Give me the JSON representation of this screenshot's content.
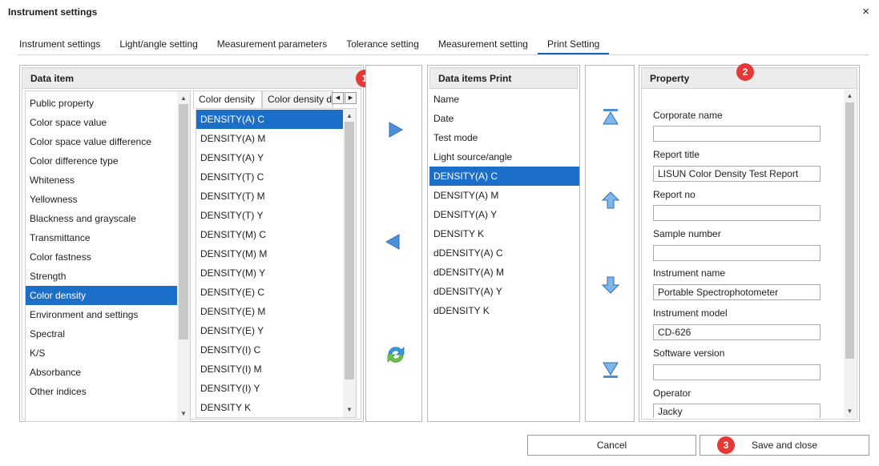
{
  "window": {
    "title": "Instrument settings",
    "close_glyph": "×"
  },
  "tabs": [
    {
      "label": "Instrument settings"
    },
    {
      "label": "Light/angle setting"
    },
    {
      "label": "Measurement parameters"
    },
    {
      "label": "Tolerance setting"
    },
    {
      "label": "Measurement setting"
    },
    {
      "label": "Print Setting",
      "active": true
    }
  ],
  "data_item": {
    "header": "Data item",
    "categories": [
      "Public property",
      "Color space value",
      "Color space value difference",
      "Color difference type",
      "Whiteness",
      "Yellowness",
      "Blackness and grayscale",
      "Transmittance",
      "Color fastness",
      "Strength",
      "Color density",
      "Environment and settings",
      "Spectral",
      "K/S",
      "Absorbance",
      "Other indices"
    ],
    "selected_category": "Color density",
    "subtabs": [
      "Color density",
      "Color density d"
    ],
    "items": [
      "DENSITY(A) C",
      "DENSITY(A) M",
      "DENSITY(A) Y",
      "DENSITY(T) C",
      "DENSITY(T) M",
      "DENSITY(T) Y",
      "DENSITY(M) C",
      "DENSITY(M) M",
      "DENSITY(M) Y",
      "DENSITY(E) C",
      "DENSITY(E) M",
      "DENSITY(E) Y",
      "DENSITY(I) C",
      "DENSITY(I) M",
      "DENSITY(I) Y",
      "DENSITY K"
    ],
    "selected_item": "DENSITY(A) C"
  },
  "print_items": {
    "header": "Data items Print",
    "items": [
      "Name",
      "Date",
      "Test mode",
      "Light source/angle",
      "DENSITY(A) C",
      "DENSITY(A) M",
      "DENSITY(A) Y",
      "DENSITY K",
      "dDENSITY(A) C",
      "dDENSITY(A) M",
      "dDENSITY(A) Y",
      "dDENSITY K"
    ],
    "selected_item": "DENSITY(A) C"
  },
  "property": {
    "header": "Property",
    "fields": [
      {
        "label": "Corporate name",
        "value": ""
      },
      {
        "label": "Report title",
        "value": "LISUN Color Density Test Report"
      },
      {
        "label": "Report no",
        "value": ""
      },
      {
        "label": "Sample number",
        "value": ""
      },
      {
        "label": "Instrument name",
        "value": "Portable Spectrophotometer"
      },
      {
        "label": "Instrument model",
        "value": "CD-626"
      },
      {
        "label": "Software version",
        "value": ""
      },
      {
        "label": "Operator",
        "value": "Jacky"
      }
    ]
  },
  "badges": [
    "1",
    "2",
    "3"
  ],
  "buttons": {
    "cancel": "Cancel",
    "save_close": "Save and close"
  },
  "colors": {
    "selection": "#1c6fc9",
    "accent": "#1565c0",
    "badge": "#e53935",
    "arrow_blue": "#4a90d9"
  },
  "icons": [
    "close-icon",
    "add-arrow-icon",
    "remove-arrow-icon",
    "refresh-icon",
    "move-top-icon",
    "move-up-icon",
    "move-down-icon",
    "move-bottom-icon"
  ]
}
